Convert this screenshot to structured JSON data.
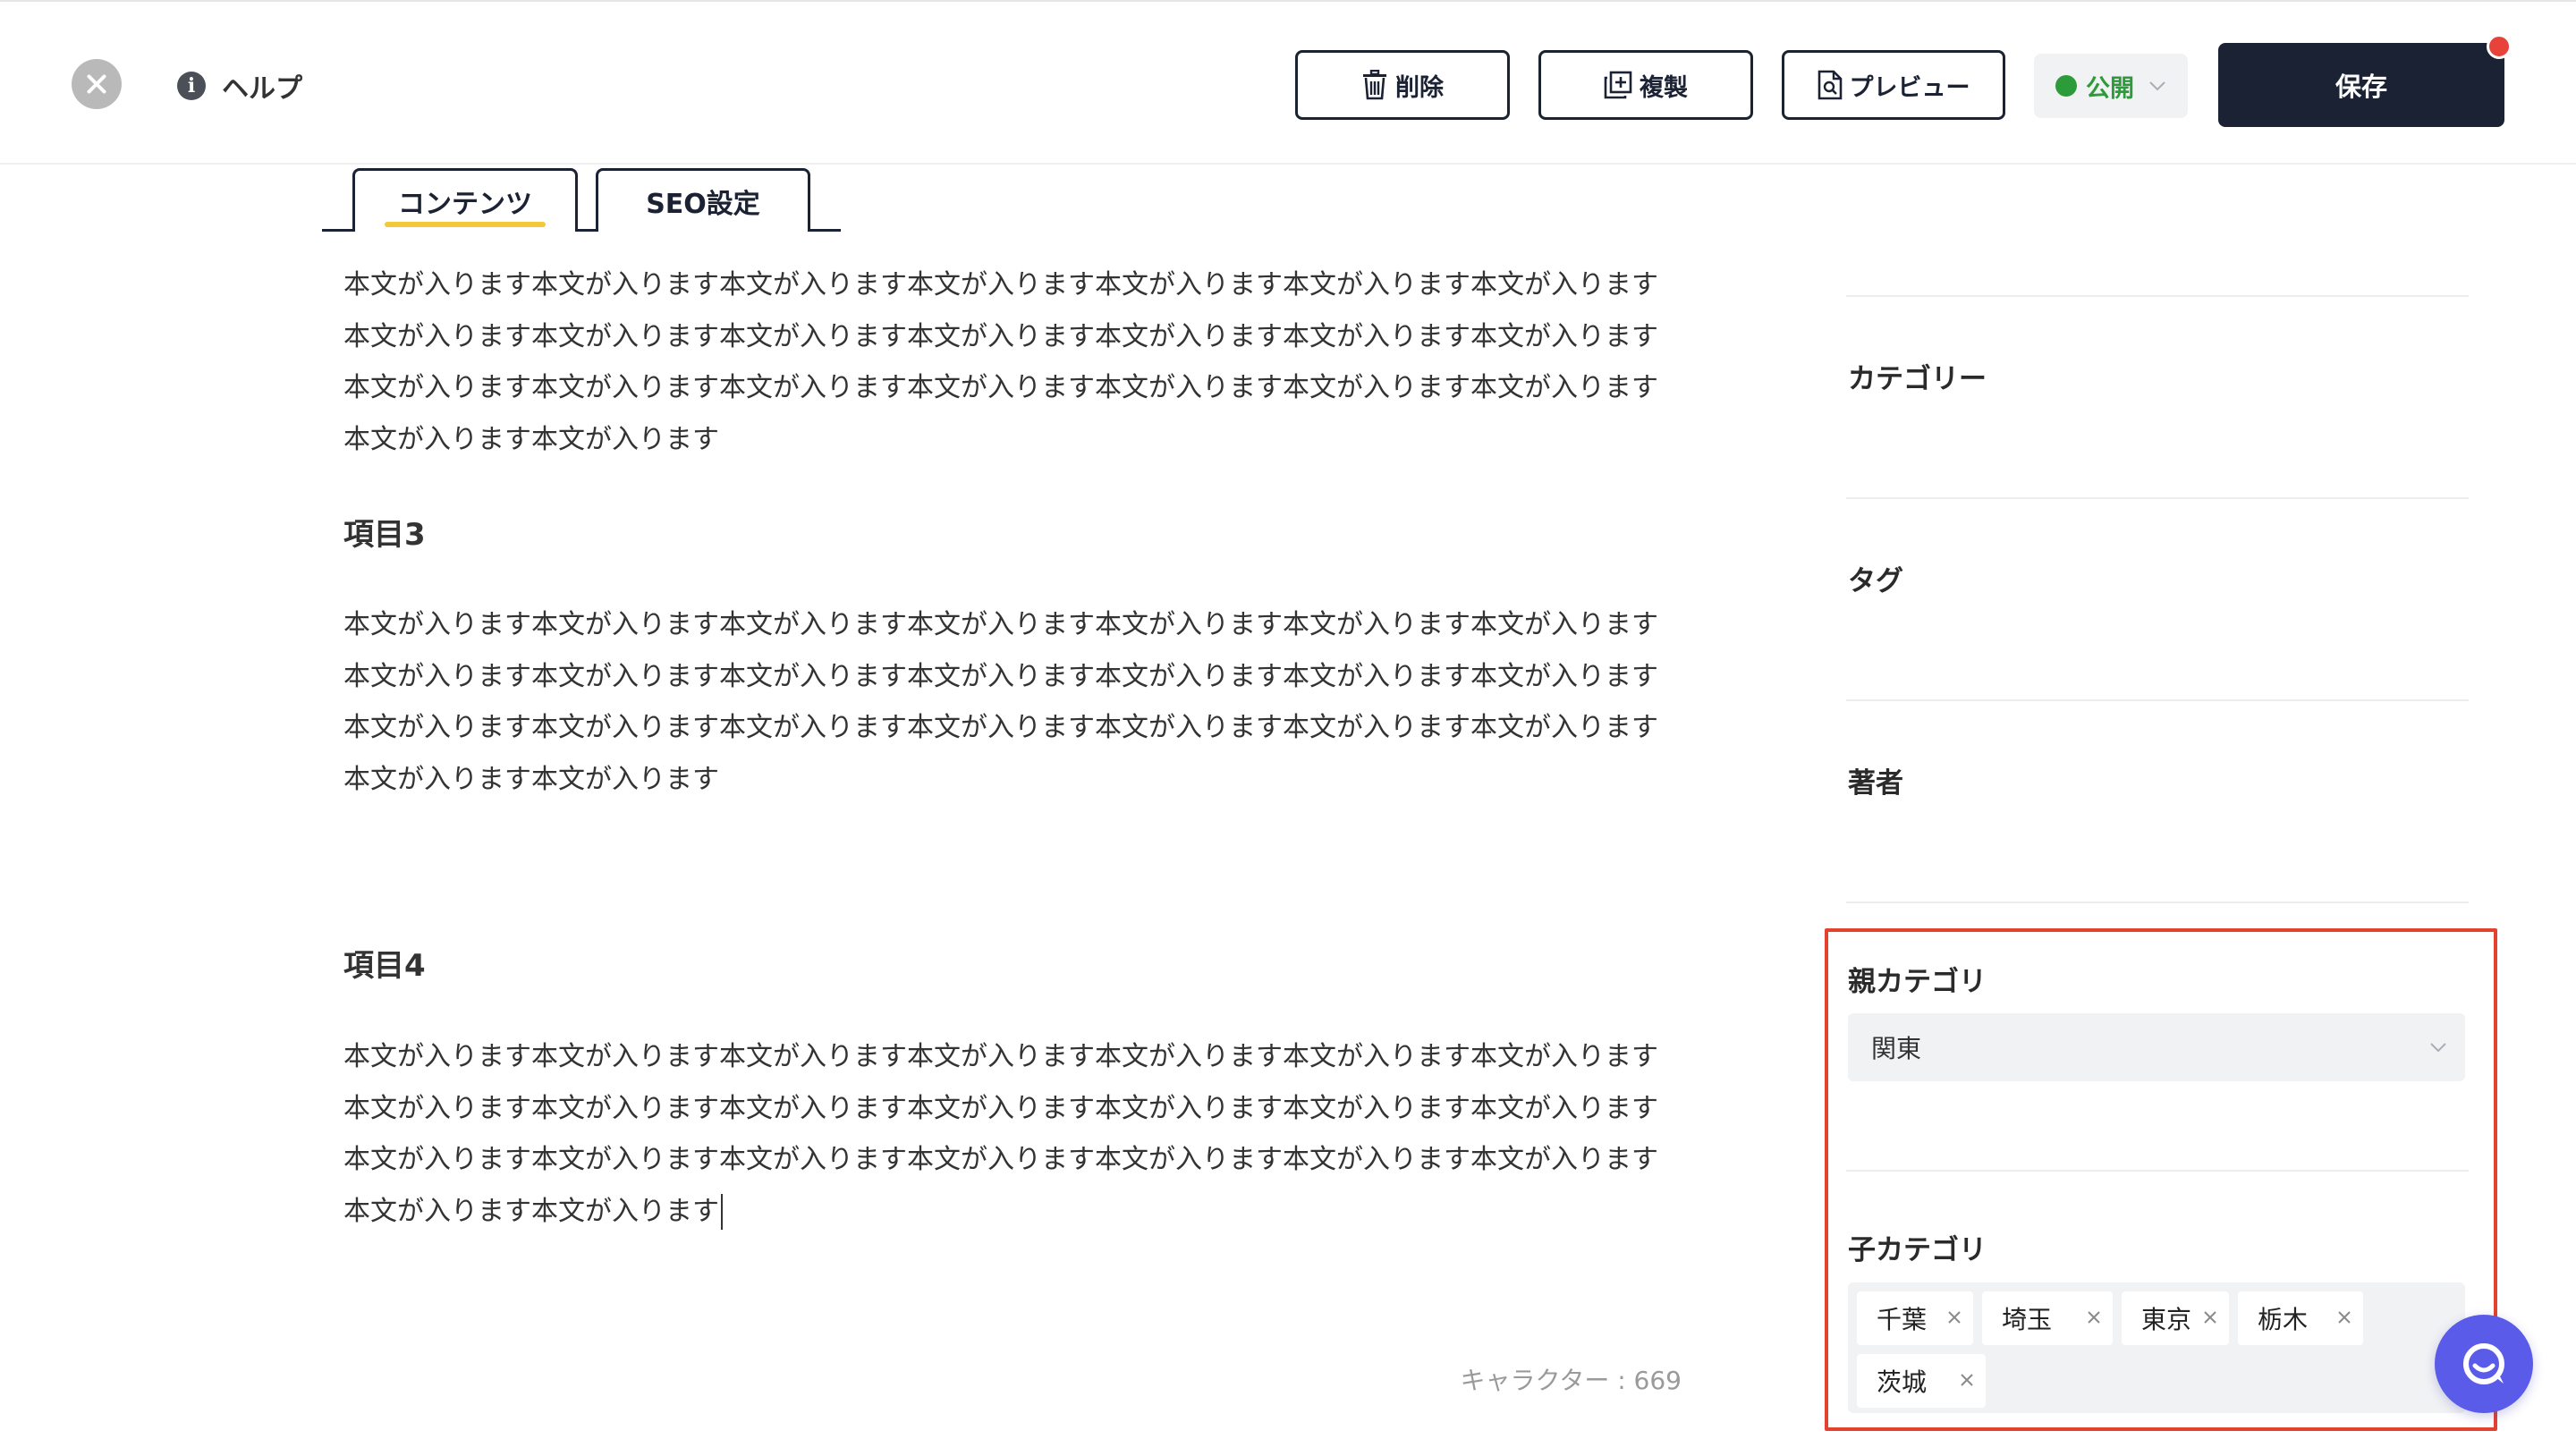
{
  "header": {
    "help_label": "ヘルプ",
    "delete_label": "削除",
    "copy_label": "複製",
    "preview_label": "プレビュー",
    "status_label": "公開",
    "save_label": "保存"
  },
  "tabs": [
    {
      "label": "コンテンツ",
      "active": true
    },
    {
      "label": "SEO設定",
      "active": false
    }
  ],
  "content": {
    "para1": "本文が入ります本文が入ります本文が入ります本文が入ります本文が入ります本文が入ります本文が入ります本文が入ります本文が入ります本文が入ります本文が入ります本文が入ります本文が入ります本文が入ります本文が入ります本文が入ります本文が入ります本文が入ります本文が入ります本文が入ります本文が入ります本文が入ります本文が入ります",
    "heading3": "項目3",
    "para2": "本文が入ります本文が入ります本文が入ります本文が入ります本文が入ります本文が入ります本文が入ります本文が入ります本文が入ります本文が入ります本文が入ります本文が入ります本文が入ります本文が入ります本文が入ります本文が入ります本文が入ります本文が入ります本文が入ります本文が入ります本文が入ります本文が入ります本文が入ります",
    "heading4": "項目4",
    "para3": "本文が入ります本文が入ります本文が入ります本文が入ります本文が入ります本文が入ります本文が入ります本文が入ります本文が入ります本文が入ります本文が入ります本文が入ります本文が入ります本文が入ります本文が入ります本文が入ります本文が入ります本文が入ります本文が入ります本文が入ります本文が入ります本文が入ります本文が入ります",
    "char_count": "キャラクター : 669"
  },
  "sidebar": {
    "category_label": "カテゴリー",
    "tag_label": "タグ",
    "author_label": "著者",
    "parent_category_label": "親カテゴリ",
    "parent_category_value": "関東",
    "child_category_label": "子カテゴリ",
    "child_categories": [
      "千葉",
      "埼玉",
      "東京",
      "栃木",
      "茨城"
    ]
  },
  "colors": {
    "primary": "#1b2233",
    "accent_underline": "#f3c83a",
    "status_green": "#2e9b3a",
    "highlight_red": "#e3432e",
    "chat_purple": "#5b5bea",
    "notification_red": "#e8433a"
  },
  "icons": {
    "close": "close-icon",
    "help": "info-icon",
    "delete": "trash-icon",
    "copy": "duplicate-icon",
    "preview": "document-search-icon",
    "status_chevron": "chevron-down-icon",
    "select_chevron": "chevron-down-icon",
    "chip_remove": "x-icon",
    "chat": "chat-icon"
  }
}
